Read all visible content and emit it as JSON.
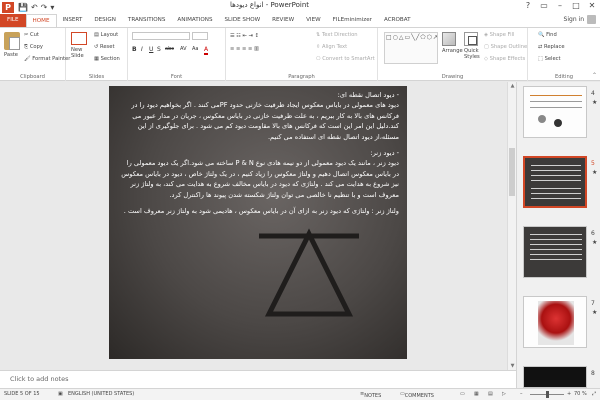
{
  "app": {
    "logo": "P",
    "title": "انواع دیودها - PowerPoint",
    "window_controls": [
      "?",
      "▭",
      "–",
      "□",
      "✕"
    ],
    "qat": [
      "💾",
      "↶",
      "↷",
      "▾"
    ]
  },
  "tabs": [
    "FILE",
    "HOME",
    "INSERT",
    "DESIGN",
    "TRANSITIONS",
    "ANIMATIONS",
    "SLIDE SHOW",
    "REVIEW",
    "VIEW",
    "FILEminimizer",
    "ACROBAT"
  ],
  "user": "Sign in",
  "ribbon": {
    "clipboard": {
      "paste": "Paste",
      "cut": "Cut",
      "copy": "Copy",
      "format_painter": "Format Painter",
      "label": "Clipboard"
    },
    "slides": {
      "new_slide": "New Slide",
      "layout": "Layout",
      "reset": "Reset",
      "section": "Section",
      "label": "Slides"
    },
    "font": {
      "label": "Font",
      "buttons": [
        "B",
        "I",
        "U",
        "S",
        "abc",
        "AV",
        "Aa",
        "A"
      ]
    },
    "paragraph": {
      "text_direction": "Text Direction",
      "align_text": "Align Text",
      "smartart": "Convert to SmartArt",
      "label": "Paragraph"
    },
    "drawing": {
      "shapes_preview": "□○△▭╲╱⬠⬡↗☆{}",
      "arrange": "Arrange",
      "quick_styles": "Quick Styles",
      "shape_fill": "Shape Fill",
      "shape_outline": "Shape Outline",
      "shape_effects": "Shape Effects",
      "label": "Drawing"
    },
    "editing": {
      "find": "Find",
      "replace": "Replace",
      "select": "Select",
      "label": "Editing"
    }
  },
  "slide": {
    "h1": "- دیود اتصال نقطه ای:",
    "p1": "دیود های معمولی در بایاس معکوس ایجاد ظرفیت خازنی حدود PFمی کنند . اگر بخواهیم دیود را در فرکانس های بالا به کار ببریم ، به علت ظرفیت خازنی در بایاس معکوس ، جریان در مدار عبور می کند.دلیل این امر این است که فرکانس های بالا مقاومت دیود کم می شود . برای جلوگیری از این مسئله،از دیود اتصال نقطه ای استفاده می کنیم.",
    "h2": "- دیود زنر:",
    "p2": "دیود زنر ، مانند یک دیود معمولی از دو نیمه هادی نوع P & N ساخته می شود.اگر یک دیود معمولی را در بایاس معکوس اتصال دهیم و ولتاژ معکوس را زیاد کنیم ، در یک ولتاژ خاص ، دیود در بایاس معکوس نیز شروع به هدایت می کند . ولتاژی که دیود در بایاس مخالف شروع به هدایت می کند، به ولتاژ زنر معروف است و با تنظیم نا خالصی می توان ولتاژ شکسته شدن پیوند ها راکنترل کرد.",
    "p3": "ولتاژ زنر : ولتاژی که دیود زنر به ازای آن در بایاس معکوس ، هادیمی شود به ولتاژ زنر معروف است ."
  },
  "notes_placeholder": "Click to add notes",
  "thumbnails": [
    {
      "number": "4",
      "star": "★"
    },
    {
      "number": "5",
      "star": "★"
    },
    {
      "number": "6",
      "star": "★"
    },
    {
      "number": "7",
      "star": "★"
    },
    {
      "number": "8",
      "star": ""
    }
  ],
  "status": {
    "slide_info": "SLIDE 5 OF 15",
    "language": "ENGLISH (UNITED STATES)",
    "notes": "NOTES",
    "comments": "COMMENTS",
    "zoom": "70 %"
  }
}
